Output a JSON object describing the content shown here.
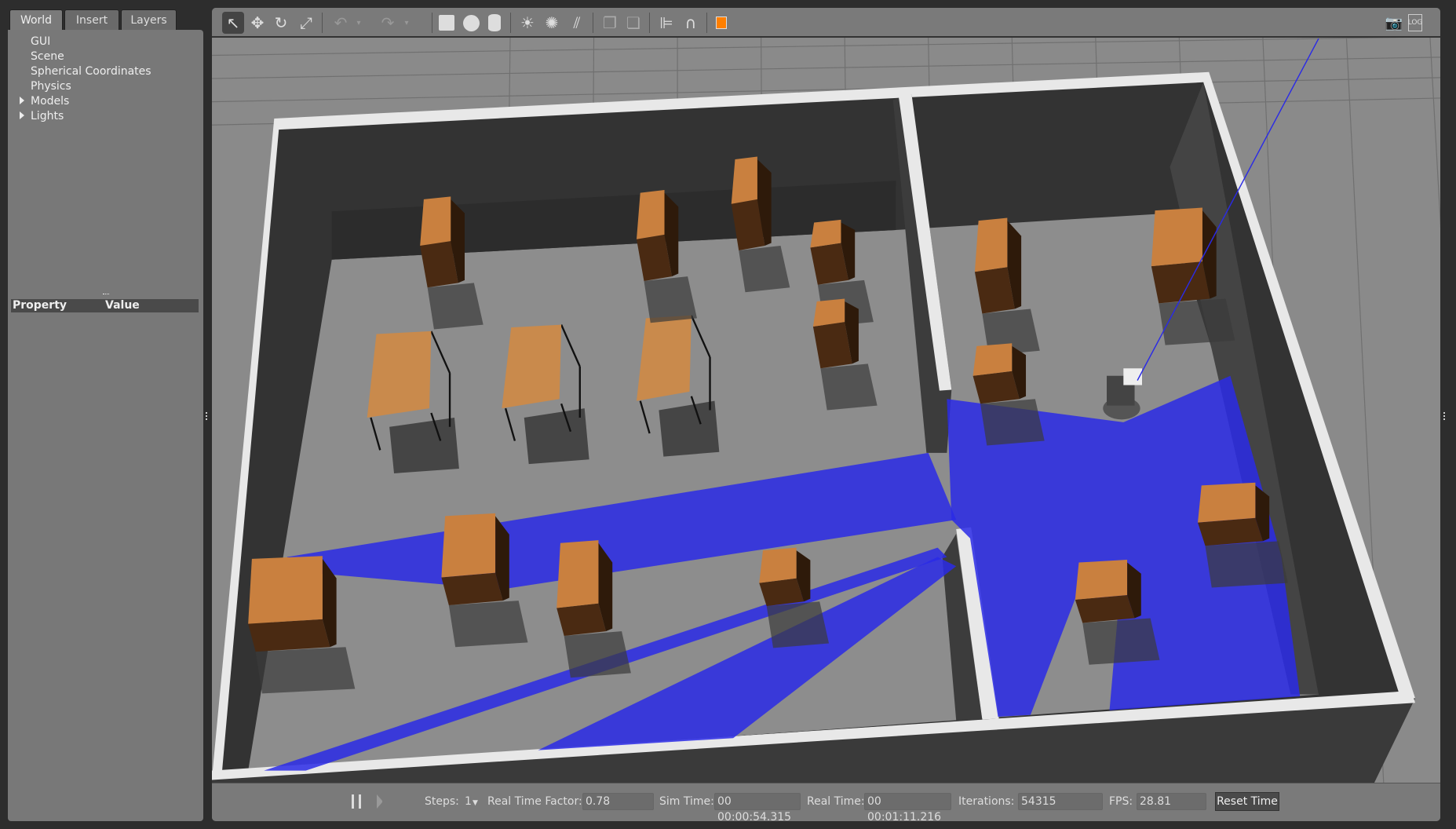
{
  "tabs": [
    {
      "label": "World"
    },
    {
      "label": "Insert"
    },
    {
      "label": "Layers"
    }
  ],
  "tree": [
    {
      "label": "GUI",
      "expandable": false
    },
    {
      "label": "Scene",
      "expandable": false
    },
    {
      "label": "Spherical Coordinates",
      "expandable": false
    },
    {
      "label": "Physics",
      "expandable": false
    },
    {
      "label": "Models",
      "expandable": true
    },
    {
      "label": "Lights",
      "expandable": true
    }
  ],
  "properties": {
    "col_property": "Property",
    "col_value": "Value"
  },
  "toolbar": [
    "select-arrow",
    "translate",
    "rotate",
    "scale",
    "undo",
    "undo-dropdown",
    "redo",
    "redo-dropdown",
    "box",
    "sphere",
    "cylinder",
    "directional-light",
    "point-light",
    "spot-light",
    "copy",
    "paste",
    "align",
    "snap-magnet",
    "view-angle"
  ],
  "toolbar_right": [
    "screenshot",
    "log"
  ],
  "bottom": {
    "steps_label": "Steps:",
    "steps_value": "1",
    "rtf_label": "Real Time Factor:",
    "rtf_value": "0.78",
    "sim_label": "Sim Time:",
    "sim_value": "00 00:00:54.315",
    "real_label": "Real Time:",
    "real_value": "00 00:01:11.216",
    "iter_label": "Iterations:",
    "iter_value": "54315",
    "fps_label": "FPS:",
    "fps_value": "28.81",
    "reset_label": "Reset Time"
  },
  "colors": {
    "laser": "#2a2ae6",
    "accent": "#ff7f00",
    "floor": "#8a8a8a",
    "wall": "#303030"
  }
}
